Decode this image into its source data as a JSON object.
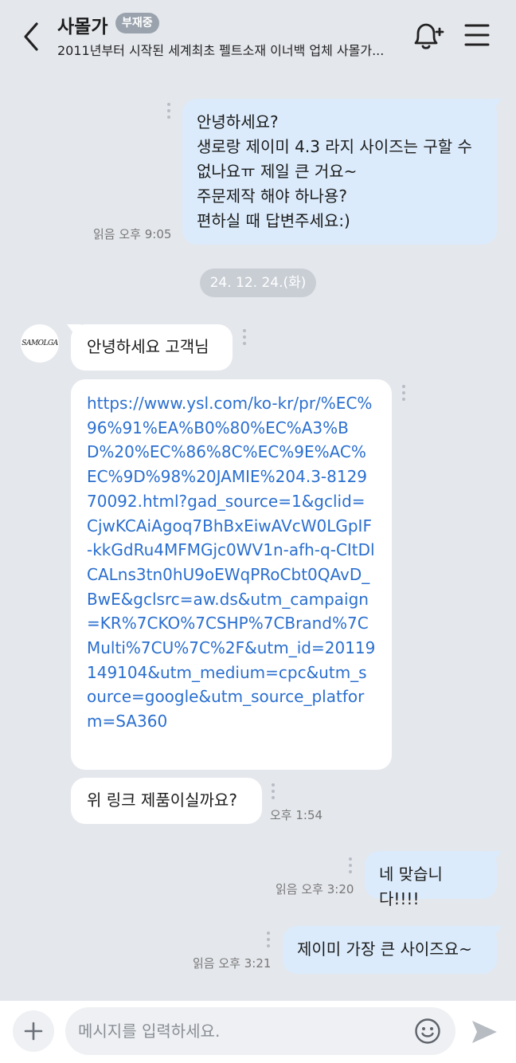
{
  "header": {
    "title": "사몰가",
    "badge": "부재중",
    "subtitle": "2011년부터 시작된 세계최초 펠트소재 이너백 업체 사몰가...",
    "back_icon": "back-arrow-icon",
    "notify_icon": "bell-plus-icon",
    "menu_icon": "hamburger-menu-icon"
  },
  "messages": {
    "m1": {
      "text": "안녕하세요?\n생로랑 제이미 4.3 라지 사이즈는 구할 수 없나요ㅠ 제일 큰 거요~\n주문제작 해야 하나용?\n편하실 때 답변주세요:)",
      "meta": "읽음 오후 9:05"
    },
    "date_divider": "24. 12. 24.(화)",
    "avatar_text": "SAMOLGA",
    "m2": {
      "text": "안녕하세요 고객님"
    },
    "m3": {
      "text": "https://www.ysl.com/ko-kr/pr/%EC%96%91%EA%B0%80%EC%A3%BD%20%EC%86%8C%EC%9E%AC%EC%9D%98%20JAMIE%204.3-812970092.html?gad_source=1&gclid=CjwKCAiAgoq7BhBxEiwAVcW0LGpIF-kkGdRu4MFMGjc0WV1n-afh-q-CItDlCALns3tn0hU9oEWqPRoCbt0QAvD_BwE&gclsrc=aw.ds&utm_campaign=KR%7CKO%7CSHP%7CBrand%7CMulti%7CU%7C%2F&utm_id=20119149104&utm_medium=cpc&utm_source=google&utm_source_platform=SA360"
    },
    "m4": {
      "text": "위 링크 제품이실까요?",
      "meta": "오후 1:54"
    },
    "m5": {
      "text": "네 맞습니다!!!!",
      "meta": "읽음 오후 3:20"
    },
    "m6": {
      "text": "제이미 가장 큰 사이즈요~",
      "meta": "읽음 오후 3:21"
    }
  },
  "composer": {
    "placeholder": "메시지를 입력하세요.",
    "plus_icon": "plus-icon",
    "emoji_icon": "emoji-icon",
    "send_icon": "send-icon"
  },
  "colors": {
    "background": "#e4e7ec",
    "my_bubble": "#dbebfb",
    "their_bubble": "#ffffff",
    "link": "#2a6fcf",
    "badge": "#9aa3ad"
  }
}
